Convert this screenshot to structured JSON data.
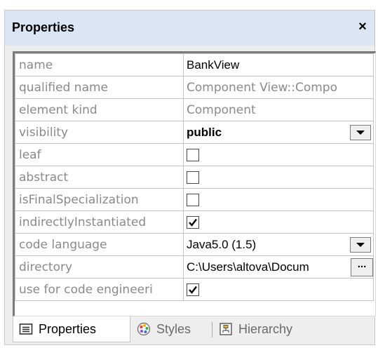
{
  "panel": {
    "title": "Properties",
    "close_label": "×"
  },
  "rows": [
    {
      "name": "name",
      "value": "BankView",
      "type": "text"
    },
    {
      "name": "qualified name",
      "value": "Component View::Compo",
      "type": "readonly"
    },
    {
      "name": "element kind",
      "value": "Component",
      "type": "readonly"
    },
    {
      "name": "visibility",
      "value": "public",
      "type": "dropdown"
    },
    {
      "name": "leaf",
      "checked": false,
      "type": "checkbox"
    },
    {
      "name": "abstract",
      "checked": false,
      "type": "checkbox"
    },
    {
      "name": "isFinalSpecialization",
      "checked": false,
      "type": "checkbox"
    },
    {
      "name": "indirectlyInstantiated",
      "checked": true,
      "type": "checkbox"
    },
    {
      "name": "code language",
      "value": "Java5.0 (1.5)",
      "type": "dropdown"
    },
    {
      "name": "directory",
      "value": "C:\\Users\\altova\\Docum",
      "type": "browse",
      "button_label": "..."
    },
    {
      "name": "use for code engineeri",
      "checked": true,
      "type": "checkbox"
    }
  ],
  "tabs": [
    {
      "label": "Properties",
      "icon": "properties-icon",
      "active": true
    },
    {
      "label": "Styles",
      "icon": "palette-icon",
      "active": false
    },
    {
      "label": "Hierarchy",
      "icon": "hierarchy-icon",
      "active": false
    }
  ],
  "colors": {
    "title_bar": "#dae6f4",
    "panel_bg": "#eeeeee",
    "readonly_text": "#8a8a8a"
  }
}
